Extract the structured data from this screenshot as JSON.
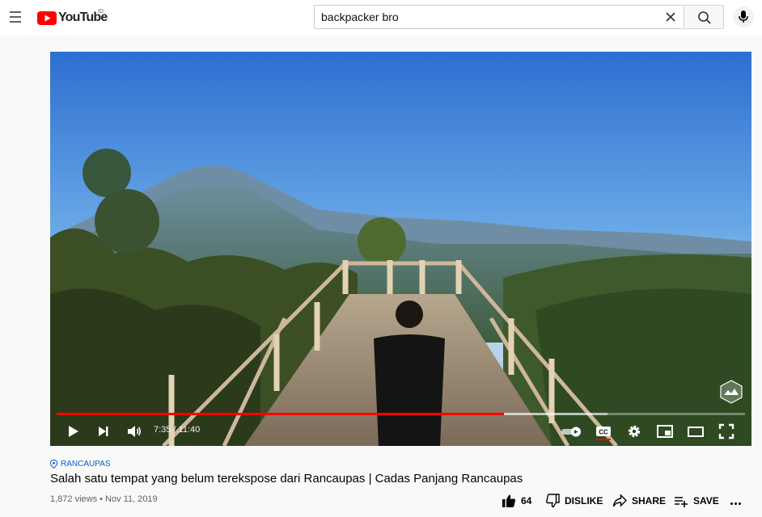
{
  "header": {
    "logo_text": "YouTube",
    "country_code": "ID",
    "search_value": "backpacker bro",
    "search_placeholder": "Search",
    "icons": [
      "menu-icon",
      "youtube-logo-icon",
      "clear-icon",
      "search-icon",
      "mic-icon"
    ]
  },
  "player": {
    "time_current": "7:35",
    "time_total": "11:40",
    "time_display": "7:35 / 11:40",
    "progress_fraction": 0.65,
    "buffered_fraction": 0.8,
    "captions_on": true,
    "icons": [
      "play-icon",
      "next-icon",
      "volume-icon",
      "autoplay-toggle-icon",
      "captions-icon",
      "settings-icon",
      "miniplayer-icon",
      "theater-icon",
      "fullscreen-icon"
    ]
  },
  "video": {
    "location": "RANCAUPAS",
    "title": "Salah satu tempat yang belum terekspose dari Rancaupas | Cadas Panjang Rancaupas",
    "views": "1,872 views",
    "date": "Nov 11, 2019",
    "meta": "1,872 views • Nov 11, 2019"
  },
  "actions": {
    "like_count": "64",
    "dislike_label": "DISLIKE",
    "share_label": "SHARE",
    "save_label": "SAVE"
  },
  "colors": {
    "youtube_red": "#ff0000",
    "link_blue": "#065fd4",
    "text_secondary": "#606060"
  }
}
